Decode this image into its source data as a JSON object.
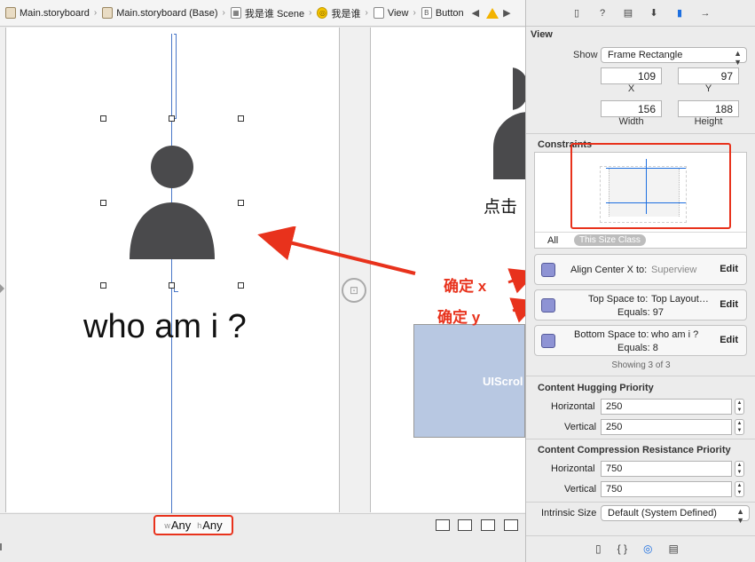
{
  "breadcrumb": {
    "items": [
      "Main.storyboard",
      "Main.storyboard (Base)",
      "我是谁 Scene",
      "我是谁",
      "View",
      "Button"
    ]
  },
  "canvas": {
    "label_text": "who am i ?",
    "scene2_text": "点击",
    "scroll_label": "UIScrol",
    "size_class": {
      "w_prefix": "w",
      "w_value": "Any",
      "h_prefix": "h",
      "h_value": "Any"
    }
  },
  "annotations": {
    "center_x": "确定 x",
    "top_y": "确定 y"
  },
  "inspector": {
    "view_title": "View",
    "show_label": "Show",
    "show_value": "Frame Rectangle",
    "x_value": "109",
    "x_label": "X",
    "y_value": "97",
    "y_label": "Y",
    "width_value": "156",
    "width_label": "Width",
    "height_value": "188",
    "height_label": "Height",
    "constraints_title": "Constraints",
    "filter_all": "All",
    "filter_size_class": "This Size Class",
    "constraints": [
      {
        "title": "Align Center X to:",
        "target": "Superview",
        "equals": "",
        "edit": "Edit"
      },
      {
        "title": "Top Space to:",
        "target": "Top Layout…",
        "equals": "Equals:  97",
        "edit": "Edit"
      },
      {
        "title": "Bottom Space to:",
        "target": "who am i ?",
        "equals": "Equals:  8",
        "edit": "Edit"
      }
    ],
    "showing": "Showing 3 of 3",
    "hugging_title": "Content Hugging Priority",
    "hugging_h_label": "Horizontal",
    "hugging_h_value": "250",
    "hugging_v_label": "Vertical",
    "hugging_v_value": "250",
    "compression_title": "Content Compression Resistance Priority",
    "compression_h_label": "Horizontal",
    "compression_h_value": "750",
    "compression_v_label": "Vertical",
    "compression_v_value": "750",
    "intrinsic_label": "Intrinsic Size",
    "intrinsic_value": "Default (System Defined)"
  },
  "colors": {
    "accent": "#1d6fe0",
    "annotation": "#e8321c",
    "guide": "#4a78c8",
    "person": "#4a4a4c"
  }
}
